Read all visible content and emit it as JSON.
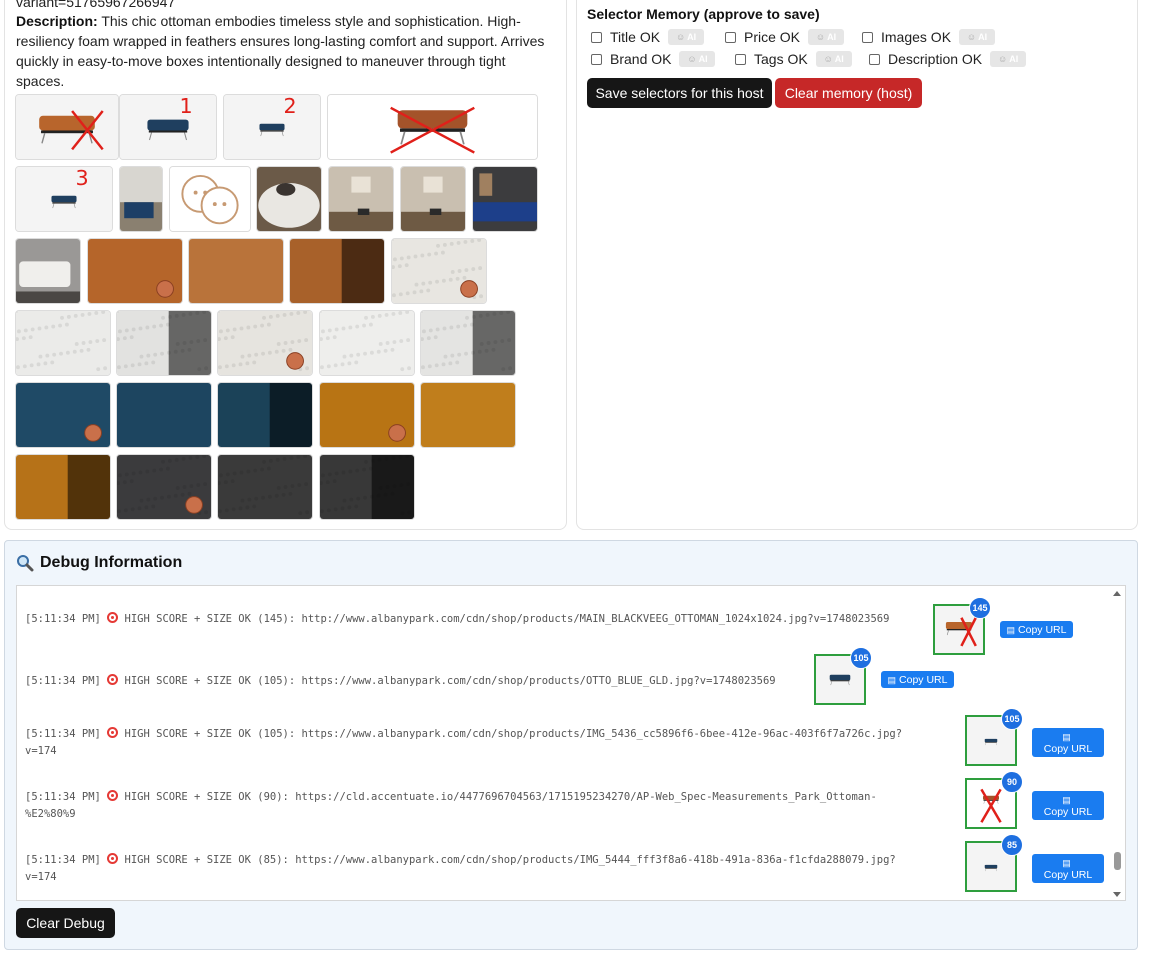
{
  "product": {
    "variant_line": "variant=51765967266947",
    "description_label": "Description:",
    "description_text": " This chic ottoman embodies timeless style and sophistication. High-resiliency foam wrapped in feathers ensures long-lasting comfort and support. Arrives quickly in easy-to-move boxes intentionally designed to maneuver through tight spaces."
  },
  "gallery": {
    "annotations": [
      "1",
      "2",
      "3"
    ],
    "images": [
      {
        "kind": "ottoman-brown-crossed"
      },
      {
        "kind": "ottoman-blue",
        "mark": "1"
      },
      {
        "kind": "ottoman-blue-small",
        "mark": "2"
      },
      {
        "kind": "ottoman-brown-large-crossed"
      },
      {
        "kind": "ottoman-blue-small",
        "mark": "3"
      },
      {
        "kind": "room-scene"
      },
      {
        "kind": "babies-icon"
      },
      {
        "kind": "cat-on-sofa"
      },
      {
        "kind": "room-wall-art"
      },
      {
        "kind": "room-wall-art"
      },
      {
        "kind": "room-blue-sofa"
      },
      {
        "kind": "room-white-sofa"
      },
      {
        "kind": "swatch",
        "color": "#b5652a",
        "coin": true
      },
      {
        "kind": "swatch",
        "color": "#b9733a"
      },
      {
        "kind": "swatch",
        "color": "#a8612a",
        "dark": true
      },
      {
        "kind": "swatch-boucle",
        "color": "#e8e6e1",
        "coin": true
      },
      {
        "kind": "swatch-boucle",
        "color": "#ebebe9"
      },
      {
        "kind": "swatch-boucle",
        "color": "#e2e2e0",
        "dark": true
      },
      {
        "kind": "swatch-boucle",
        "color": "#e6e4df",
        "coin": true
      },
      {
        "kind": "swatch-boucle",
        "color": "#eeeeec"
      },
      {
        "kind": "swatch-boucle",
        "color": "#e4e4e2",
        "dark": true
      },
      {
        "kind": "swatch",
        "color": "#1f4a66",
        "coin": true
      },
      {
        "kind": "swatch",
        "color": "#1d4560"
      },
      {
        "kind": "swatch",
        "color": "#1b4258",
        "dark": true
      },
      {
        "kind": "swatch",
        "color": "#b87414",
        "coin": true
      },
      {
        "kind": "swatch",
        "color": "#c07e1c"
      },
      {
        "kind": "swatch",
        "color": "#b67218",
        "dark": true
      },
      {
        "kind": "swatch-boucle",
        "color": "#3b3b3d",
        "coin": true
      },
      {
        "kind": "swatch-boucle",
        "color": "#3a3a3a"
      },
      {
        "kind": "swatch-boucle",
        "color": "#383838",
        "dark": true
      }
    ]
  },
  "selector_memory": {
    "title": "Selector Memory (approve to save)",
    "ai_label": "AI",
    "checks": [
      {
        "label": "Title OK",
        "checked": false
      },
      {
        "label": "Price OK",
        "checked": false
      },
      {
        "label": "Images OK",
        "checked": false
      },
      {
        "label": "Brand OK",
        "checked": false
      },
      {
        "label": "Tags OK",
        "checked": false
      },
      {
        "label": "Description OK",
        "checked": false
      }
    ],
    "save_button": "Save selectors for this host",
    "clear_button": "Clear memory (host)"
  },
  "debug": {
    "icon": "magnifier-icon",
    "title": "Debug Information",
    "copy_label": "Copy URL",
    "clear_button": "Clear Debug",
    "entries": [
      {
        "text": "[5:11:34 PM] __T__ HIGH SCORE + SIZE OK (145): http://www.albanypark.com/cdn/shop/products/MAIN_BLACKVEEG_OTTOMAN_1024x1024.jpg?v=1748023569",
        "score": "145",
        "thumb": "ottoman-brown-crossed"
      },
      {
        "text": "[5:11:34 PM] __T__ HIGH SCORE + SIZE OK (105): https://www.albanypark.com/cdn/shop/products/OTTO_BLUE_GLD.jpg?v=1748023569",
        "score": "105",
        "thumb": "ottoman-blue"
      },
      {
        "text": "[5:11:34 PM] __T__ HIGH SCORE + SIZE OK (105): https://www.albanypark.com/cdn/shop/products/IMG_5436_cc5896f6-6bee-412e-96ac-403f6f7a726c.jpg?\nv=174",
        "score": "105",
        "thumb": "ottoman-blue-small"
      },
      {
        "text": "[5:11:34 PM] __T__ HIGH SCORE + SIZE OK (90): https://cld.accentuate.io/4477696704563/1715195234270/AP-Web_Spec-Measurements_Park_Ottoman-\n%E2%80%9",
        "score": "90",
        "thumb": "ottoman-brown-large-crossed"
      },
      {
        "text": "[5:11:34 PM] __T__ HIGH SCORE + SIZE OK (85): https://www.albanypark.com/cdn/shop/products/IMG_5444_fff3f8a6-418b-491a-836a-f1cfda288079.jpg?\nv=174",
        "score": "85",
        "thumb": "ottoman-blue-small"
      }
    ]
  }
}
